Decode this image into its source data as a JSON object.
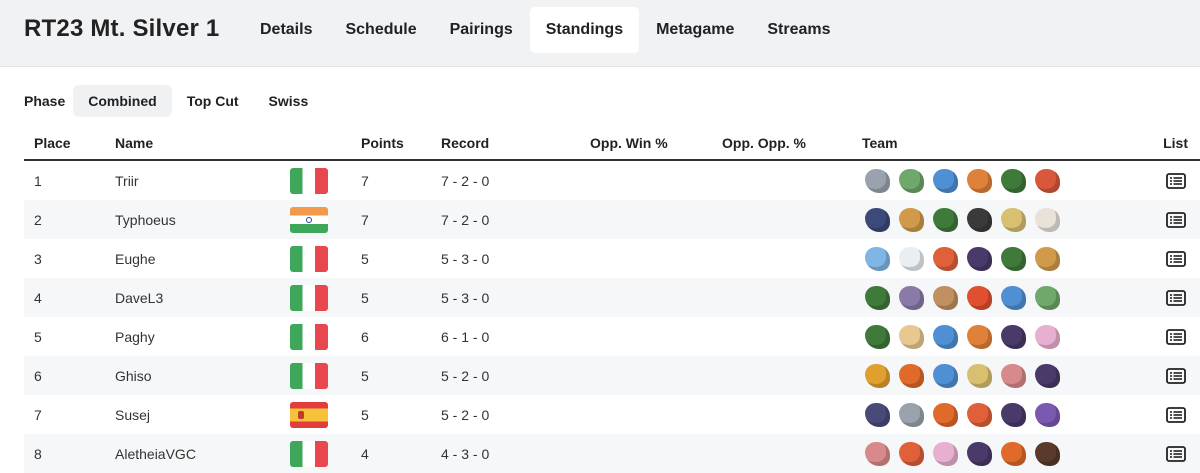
{
  "header": {
    "title": "RT23 Mt. Silver 1",
    "tabs": [
      {
        "label": "Details",
        "active": false
      },
      {
        "label": "Schedule",
        "active": false
      },
      {
        "label": "Pairings",
        "active": false
      },
      {
        "label": "Standings",
        "active": true
      },
      {
        "label": "Metagame",
        "active": false
      },
      {
        "label": "Streams",
        "active": false
      }
    ]
  },
  "phase": {
    "label": "Phase",
    "options": [
      {
        "label": "Combined",
        "active": true
      },
      {
        "label": "Top Cut",
        "active": false
      },
      {
        "label": "Swiss",
        "active": false
      }
    ]
  },
  "table": {
    "columns": {
      "place": "Place",
      "name": "Name",
      "points": "Points",
      "record": "Record",
      "opp_win": "Opp. Win %",
      "opp_opp": "Opp. Opp. %",
      "team": "Team",
      "list": "List"
    },
    "rows": [
      {
        "place": "1",
        "name": "Triir",
        "flag": "it",
        "points": "7",
        "record": "7 - 2 - 0",
        "team": [
          "#9aa3ad",
          "#6fa86a",
          "#4f8fd4",
          "#e0813a",
          "#3f7a3a",
          "#d9573a"
        ]
      },
      {
        "place": "2",
        "name": "Typhoeus",
        "flag": "in",
        "points": "7",
        "record": "7 - 2 - 0",
        "team": [
          "#3b4a7a",
          "#d09a4a",
          "#3f7a3a",
          "#3a3a3a",
          "#d8c070",
          "#e8e2d8"
        ]
      },
      {
        "place": "3",
        "name": "Eughe",
        "flag": "it",
        "points": "5",
        "record": "5 - 3 - 0",
        "team": [
          "#7fb6e6",
          "#e8eef2",
          "#e0603a",
          "#4a3a6a",
          "#3f7a3a",
          "#d09a4a"
        ]
      },
      {
        "place": "4",
        "name": "DaveL3",
        "flag": "it",
        "points": "5",
        "record": "5 - 3 - 0",
        "team": [
          "#3f7a3a",
          "#8a7aa8",
          "#c09060",
          "#e05030",
          "#4f8fd4",
          "#6fa86a"
        ]
      },
      {
        "place": "5",
        "name": "Paghy",
        "flag": "it",
        "points": "6",
        "record": "6 - 1 - 0",
        "team": [
          "#3f7a3a",
          "#e8c890",
          "#4f8fd4",
          "#e0813a",
          "#4a3a6a",
          "#e8b0d0"
        ]
      },
      {
        "place": "6",
        "name": "Ghiso",
        "flag": "it",
        "points": "5",
        "record": "5 - 2 - 0",
        "team": [
          "#e0a030",
          "#e06a2a",
          "#4f8fd4",
          "#d8c070",
          "#d88a8a",
          "#4a3a6a"
        ]
      },
      {
        "place": "7",
        "name": "Susej",
        "flag": "es",
        "points": "5",
        "record": "5 - 2 - 0",
        "team": [
          "#4a4a7a",
          "#9aa3ad",
          "#e06a2a",
          "#e0603a",
          "#4a3a6a",
          "#7a5ab0"
        ]
      },
      {
        "place": "8",
        "name": "AletheiaVGC",
        "flag": "it",
        "points": "4",
        "record": "4 - 3 - 0",
        "team": [
          "#d88a8a",
          "#e0603a",
          "#e8b0d0",
          "#4a3a6a",
          "#e06a2a",
          "#5a3a2a"
        ]
      }
    ]
  }
}
